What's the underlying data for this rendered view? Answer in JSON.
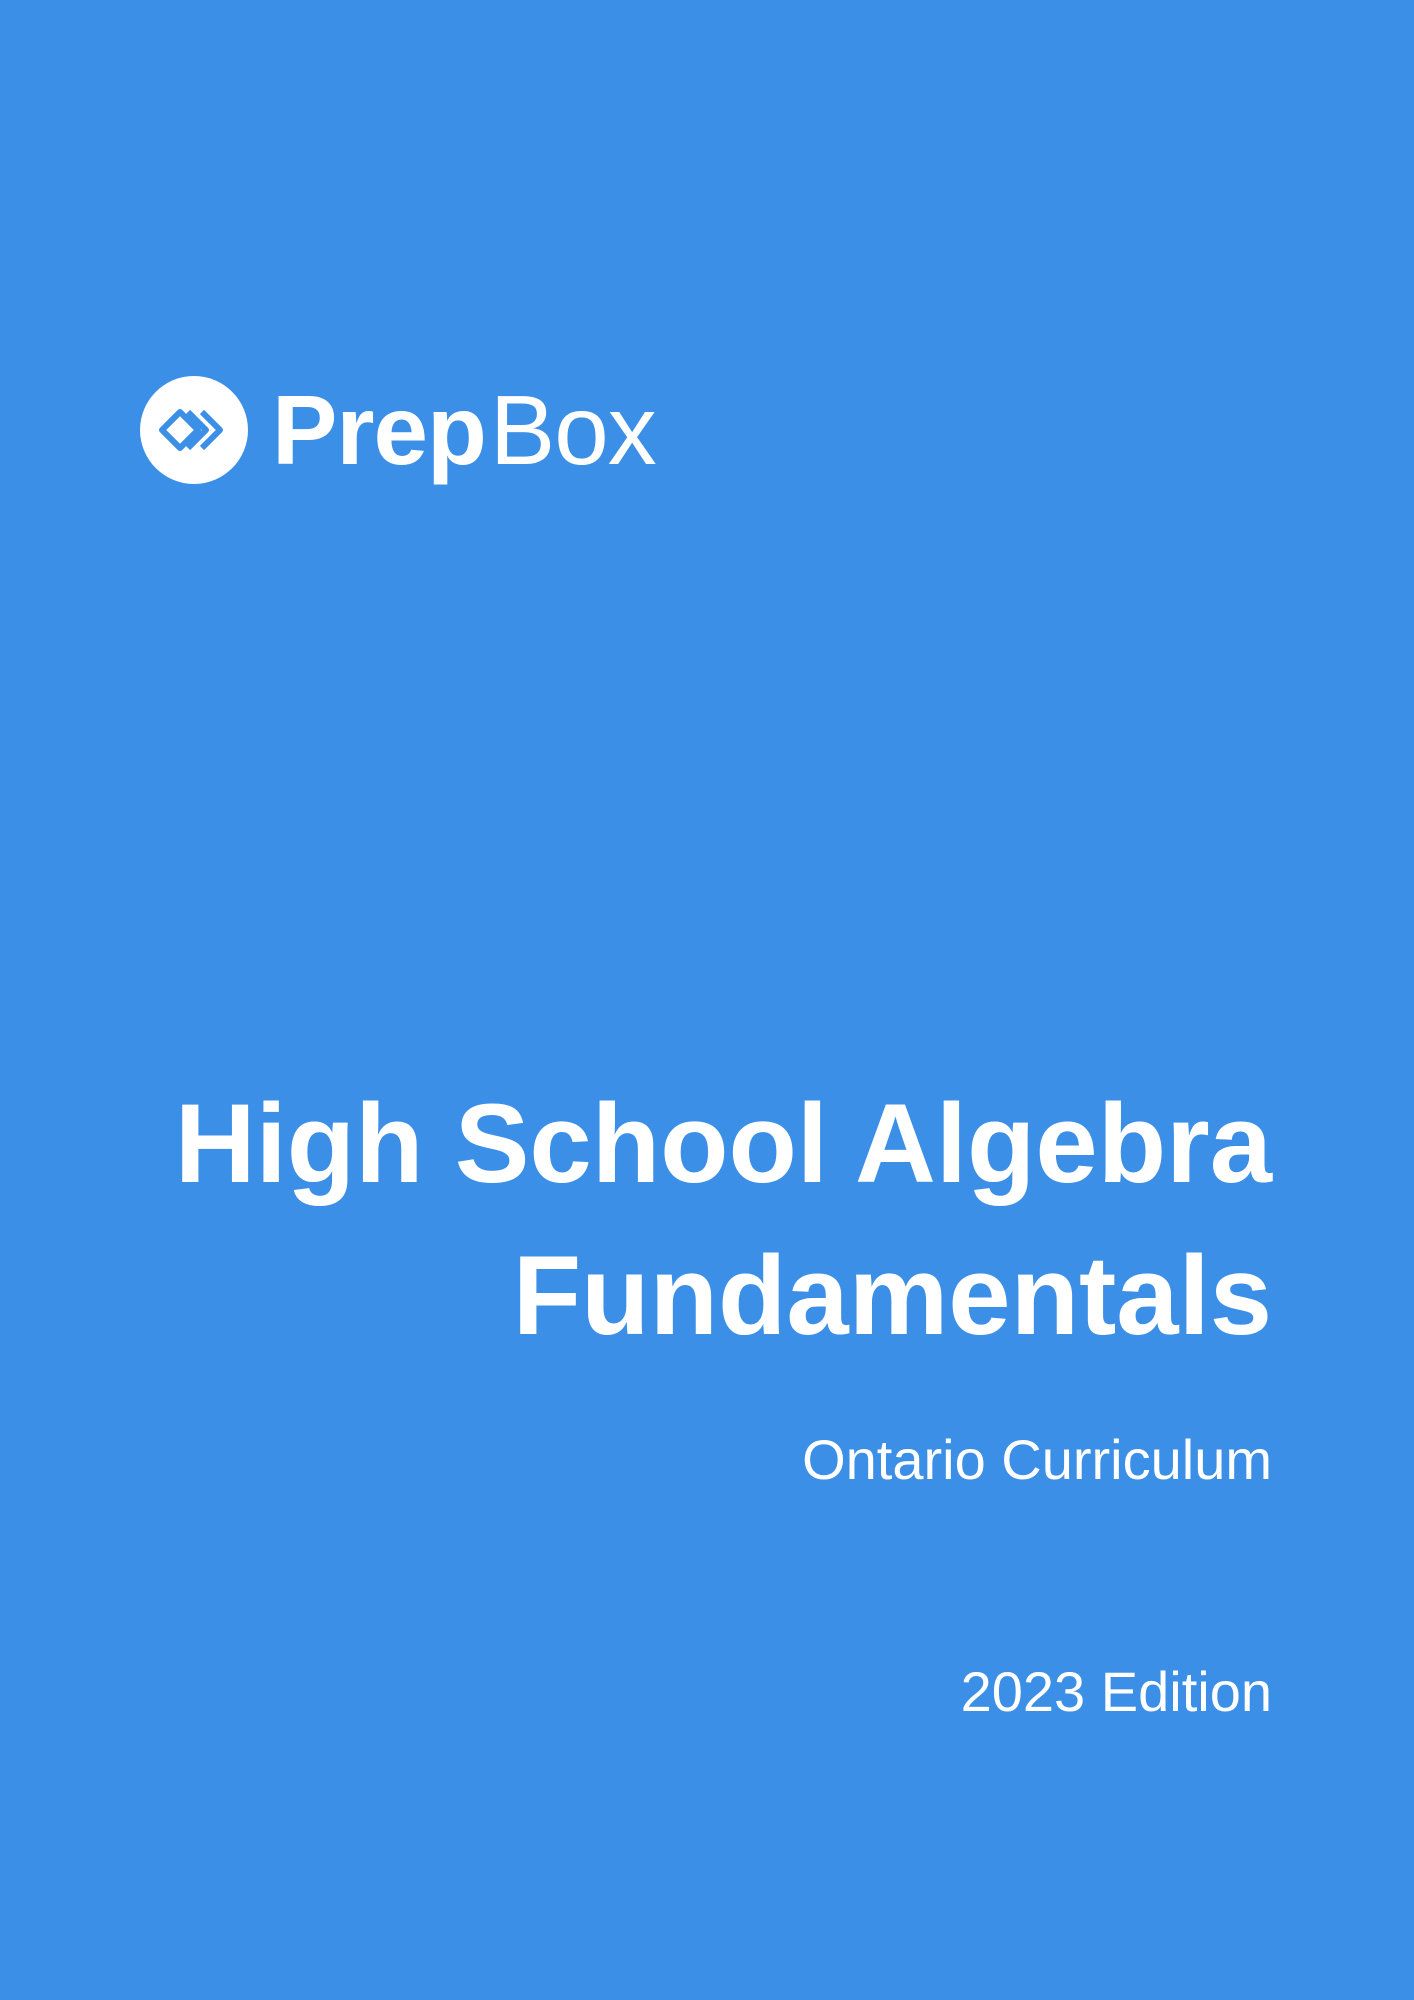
{
  "theme": {
    "background_color": "#3c8fe7",
    "text_color": "#ffffff"
  },
  "brand": {
    "logo_icon": "prepbox-chevron-badge-icon",
    "name_bold": "Prep",
    "name_light": "Box"
  },
  "title": {
    "line1": "High School Algebra",
    "line2": "Fundamentals"
  },
  "subtitle": "Ontario Curriculum",
  "edition": "2023 Edition"
}
